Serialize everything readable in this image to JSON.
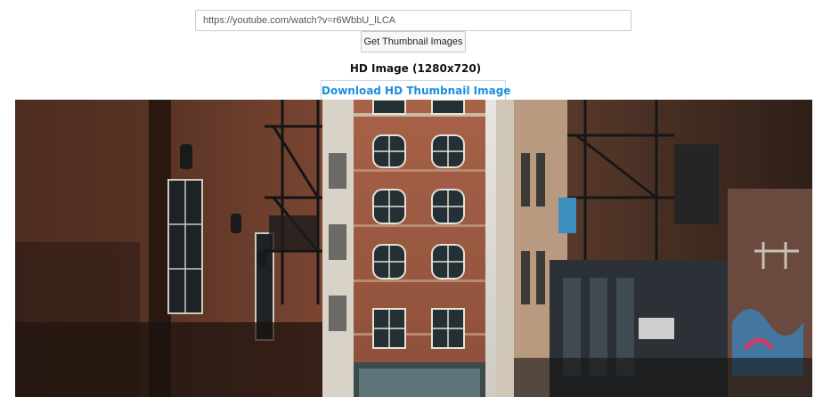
{
  "url_input": {
    "value": "https://youtube.com/watch?v=r6WbbU_lLCA"
  },
  "get_button": {
    "label": "Get Thumbnail Images"
  },
  "hd_section": {
    "heading": "HD Image (1280x720)",
    "download_label": "Download HD Thumbnail Image"
  },
  "thumbnail": {
    "alt": "HD thumbnail preview",
    "accent_colors": {
      "brick": "#8a4a35",
      "link_blue": "#1a8fe0"
    }
  }
}
